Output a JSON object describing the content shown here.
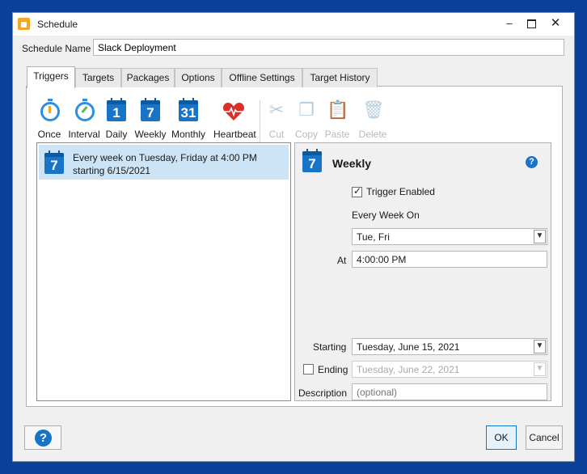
{
  "window": {
    "title": "Schedule"
  },
  "schedule_name": {
    "label": "Schedule Name",
    "value": "Slack Deployment"
  },
  "tabs": [
    {
      "label": "Triggers",
      "active": true
    },
    {
      "label": "Targets"
    },
    {
      "label": "Packages"
    },
    {
      "label": "Options"
    },
    {
      "label": "Offline Settings"
    },
    {
      "label": "Target History"
    }
  ],
  "toolbar": {
    "once": "Once",
    "interval": "Interval",
    "daily": "Daily",
    "daily_icon": "1",
    "weekly": "Weekly",
    "weekly_icon": "7",
    "monthly": "Monthly",
    "monthly_icon": "31",
    "heartbeat": "Heartbeat",
    "cut": "Cut",
    "copy": "Copy",
    "paste": "Paste",
    "delete": "Delete"
  },
  "triggers": [
    {
      "icon": "7",
      "text": "Every week on Tuesday, Friday at 4:00 PM starting 6/15/2021"
    }
  ],
  "detail": {
    "icon": "7",
    "title": "Weekly",
    "help": "?",
    "trigger_enabled_label": "Trigger Enabled",
    "trigger_enabled": true,
    "every_week_on_label": "Every Week On",
    "days_value": "Tue, Fri",
    "at_label": "At",
    "at_value": "4:00:00 PM",
    "starting_label": "Starting",
    "starting_value": "Tuesday, June 15, 2021",
    "ending_label": "Ending",
    "ending_enabled": false,
    "ending_value": "Tuesday, June 22, 2021",
    "description_label": "Description",
    "description_placeholder": "(optional)"
  },
  "footer": {
    "help": "?",
    "ok": "OK",
    "cancel": "Cancel"
  },
  "colors": {
    "accent": "#1874c7",
    "selection": "#cde4f7",
    "background": "#0b3f99"
  }
}
